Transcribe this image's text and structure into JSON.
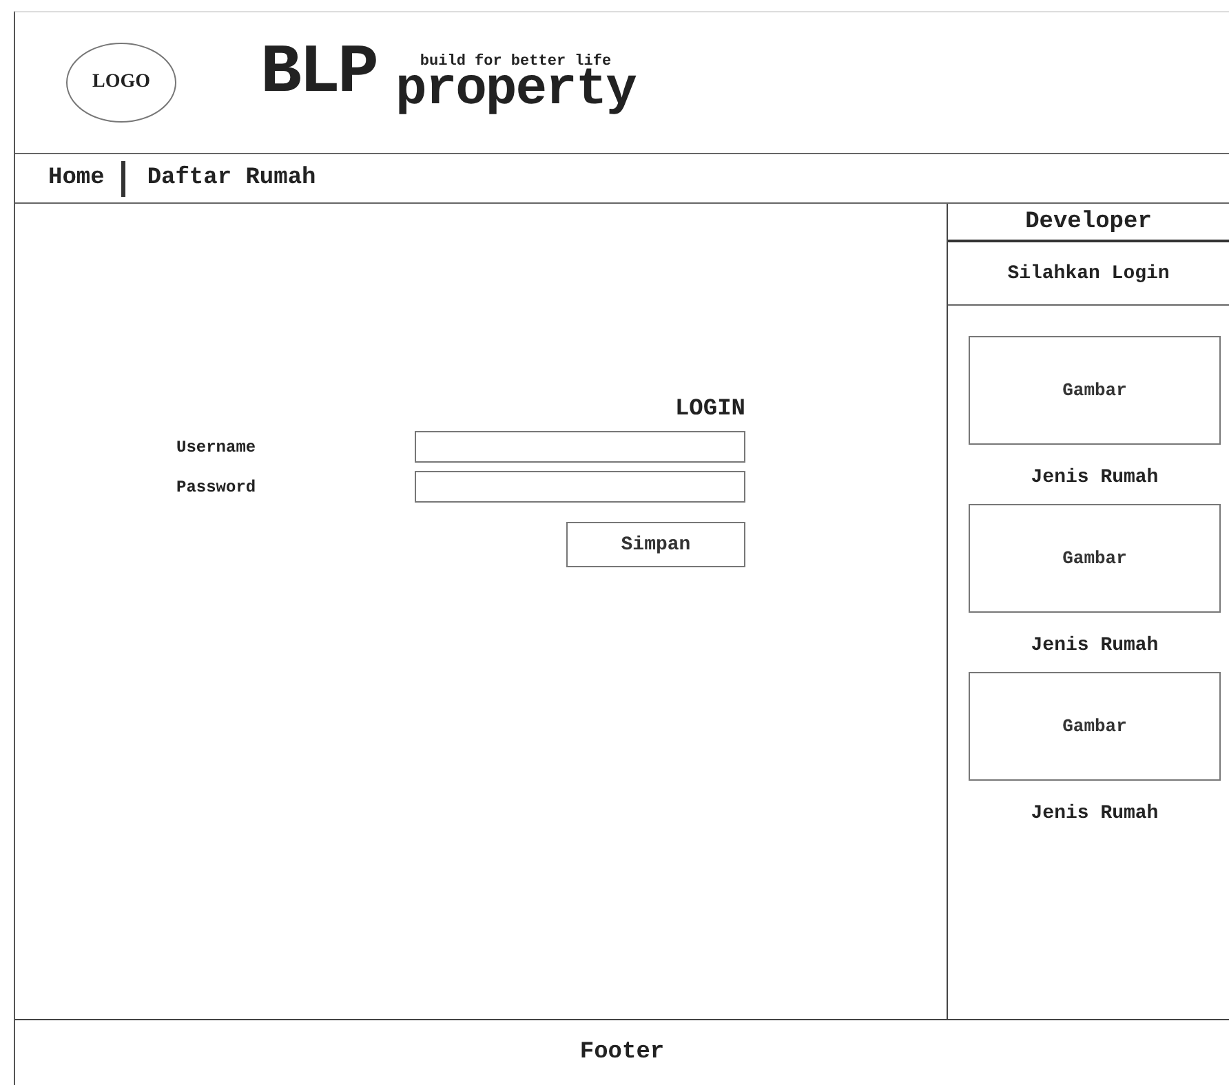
{
  "header": {
    "logo": "LOGO",
    "brand": "BLP",
    "brand_suffix": "property",
    "tagline": "build for better life"
  },
  "nav": {
    "items": [
      {
        "label": "Home"
      },
      {
        "label": "Daftar Rumah"
      }
    ]
  },
  "login": {
    "title": "LOGIN",
    "fields": [
      {
        "label": "Username"
      },
      {
        "label": "Password"
      }
    ],
    "button": "Simpan"
  },
  "sidebar": {
    "title": "Developer",
    "login_prompt": "Silahkan Login",
    "cards": [
      {
        "image_label": "Gambar",
        "caption": "Jenis Rumah"
      },
      {
        "image_label": "Gambar",
        "caption": "Jenis Rumah"
      },
      {
        "image_label": "Gambar",
        "caption": "Jenis Rumah"
      }
    ]
  },
  "footer": {
    "text": "Footer"
  }
}
